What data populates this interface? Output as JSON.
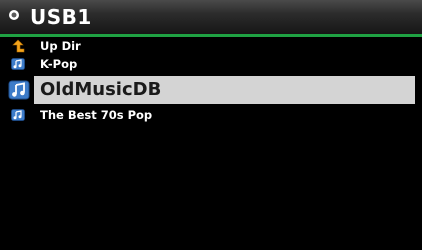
{
  "header": {
    "title": "USB1",
    "icon": "usb-device-icon",
    "accent_color": "#1fa243"
  },
  "list": {
    "items": [
      {
        "label": "Up Dir",
        "icon": "up-arrow-icon",
        "selected": false
      },
      {
        "label": "K-Pop",
        "icon": "music-folder-icon",
        "selected": false
      },
      {
        "label": "OldMusicDB",
        "icon": "music-folder-icon",
        "selected": true
      },
      {
        "label": "The Best 70s Pop",
        "icon": "music-folder-icon",
        "selected": false
      }
    ],
    "selection_color": "#d4d4d4"
  }
}
